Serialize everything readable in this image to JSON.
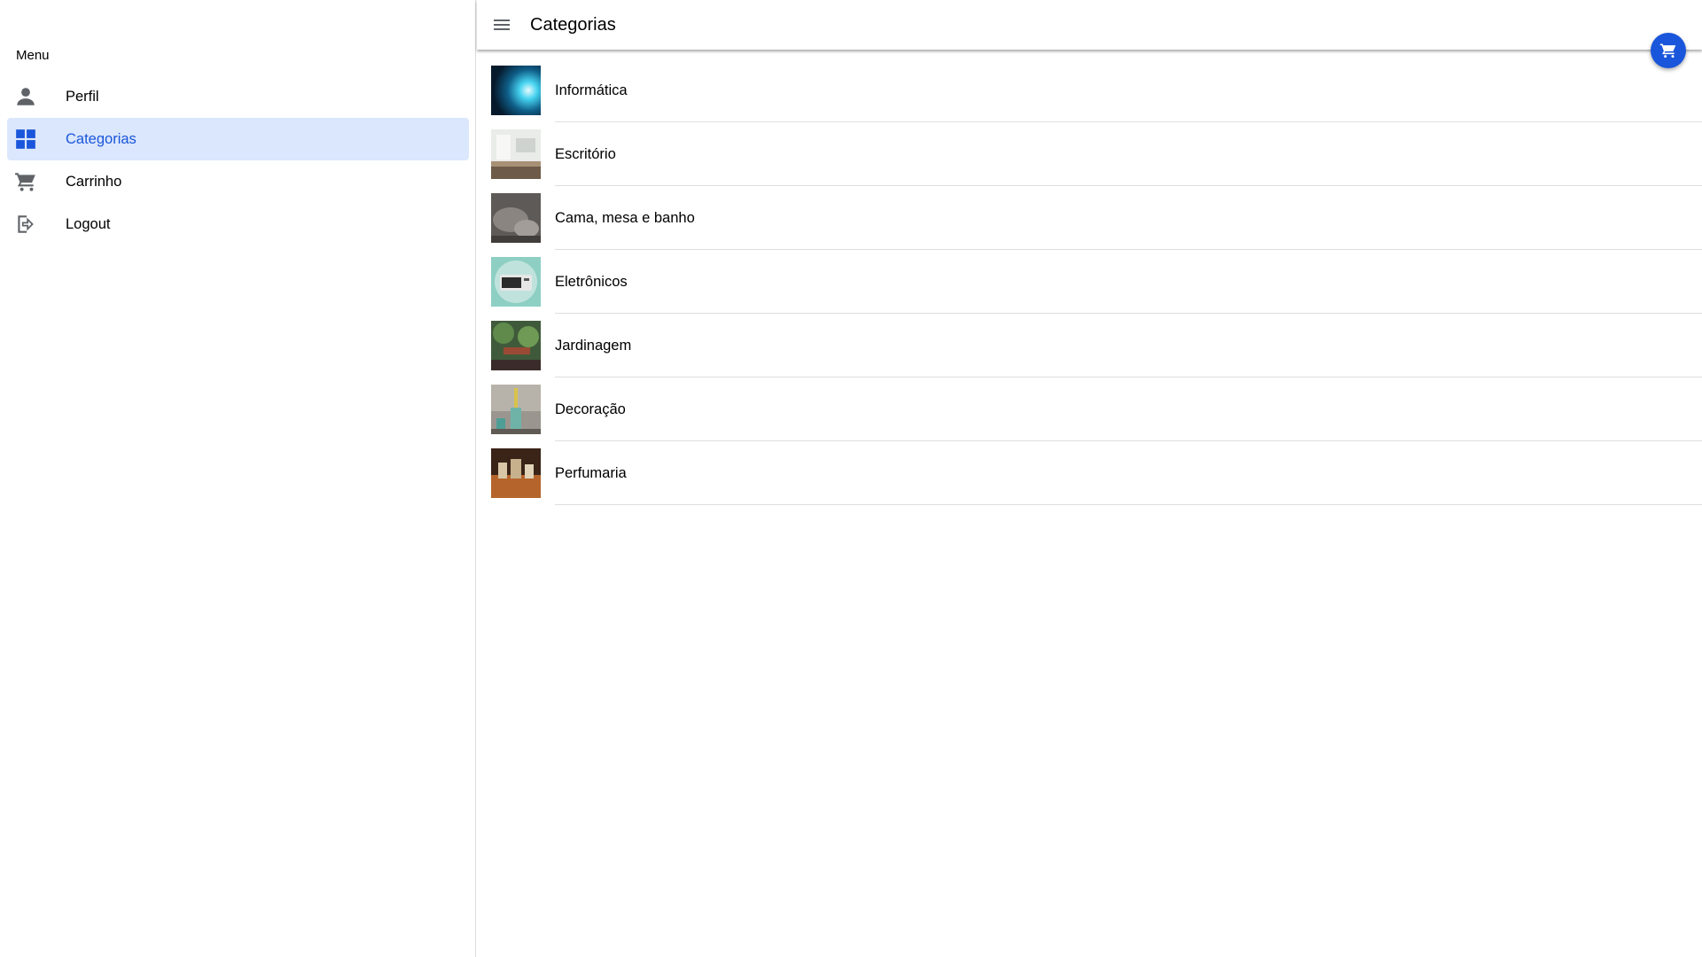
{
  "menu": {
    "header": "Menu",
    "items": [
      {
        "label": "Perfil",
        "icon": "person-icon",
        "active": false
      },
      {
        "label": "Categorias",
        "icon": "grid-icon",
        "active": true
      },
      {
        "label": "Carrinho",
        "icon": "cart-icon",
        "active": false
      },
      {
        "label": "Logout",
        "icon": "logout-icon",
        "active": false
      }
    ]
  },
  "toolbar": {
    "title": "Categorias",
    "menu_icon": "hamburger-menu-icon"
  },
  "fab": {
    "icon": "cart-icon"
  },
  "categories": [
    {
      "label": "Informática"
    },
    {
      "label": "Escritório"
    },
    {
      "label": "Cama, mesa e banho"
    },
    {
      "label": "Eletrônicos"
    },
    {
      "label": "Jardinagem"
    },
    {
      "label": "Decoração"
    },
    {
      "label": "Perfumaria"
    }
  ],
  "colors": {
    "accent": "#1a56db",
    "active_background": "#dbe7fc",
    "icon_gray": "#5f6368",
    "divider": "#dedede"
  }
}
